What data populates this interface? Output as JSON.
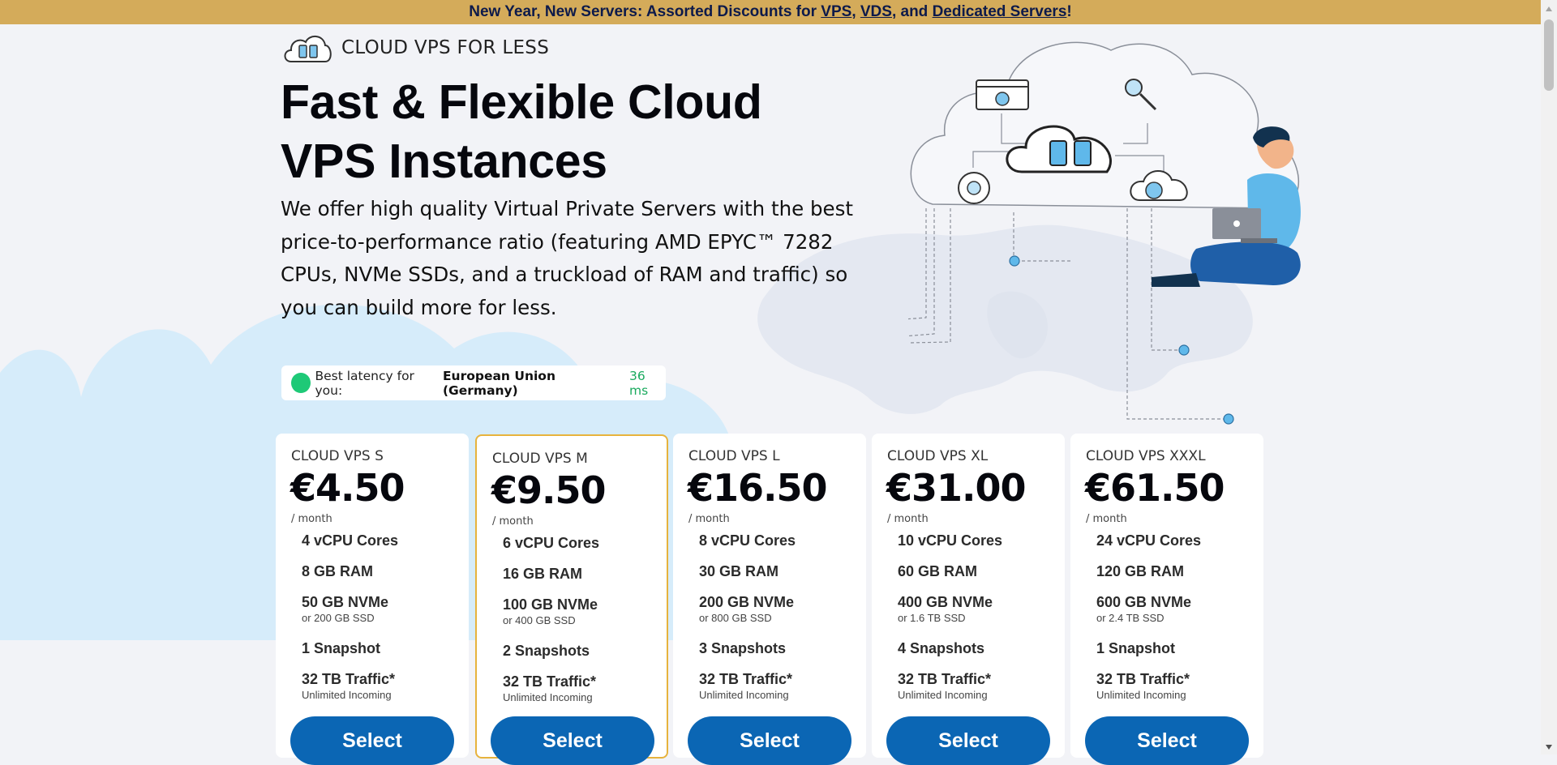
{
  "banner": {
    "prefix": "New Year, New Servers: Assorted Discounts for ",
    "link_vps": "VPS",
    "sep1": ", ",
    "link_vds": "VDS",
    "sep2": ", and ",
    "link_dedicated": "Dedicated Servers",
    "suffix": "!",
    "bg_color": "#d4ab5a"
  },
  "brand": {
    "name": "CLOUD VPS FOR LESS",
    "icon": "cloud-servers-icon"
  },
  "hero": {
    "title": "Fast & Flexible Cloud VPS Instances",
    "description": "We offer high quality Virtual Private Servers with the best price-to-performance ratio (featuring AMD EPYC™ 7282 CPUs, NVMe SSDs, and a truckload of RAM and traffic) so you can build more for less."
  },
  "latency": {
    "label": "Best latency for you:",
    "region": "European Union (Germany)",
    "value": "36 ms",
    "status_color": "#1ec977"
  },
  "colors": {
    "accent_button": "#0b66b4",
    "featured_border": "#e7b33d",
    "background": "#f2f3f7"
  },
  "plans": [
    {
      "name": "CLOUD VPS S",
      "price": "€4.50",
      "period": "/ month",
      "cores": "4 vCPU Cores",
      "ram": "8 GB RAM",
      "storage": "50 GB NVMe",
      "storage_alt": "or 200 GB SSD",
      "snapshots": "1 Snapshot",
      "traffic": "32 TB Traffic*",
      "traffic_note": "Unlimited Incoming",
      "button": "Select",
      "featured": false
    },
    {
      "name": "CLOUD VPS M",
      "price": "€9.50",
      "period": "/ month",
      "cores": "6 vCPU Cores",
      "ram": "16 GB RAM",
      "storage": "100 GB NVMe",
      "storage_alt": "or 400 GB SSD",
      "snapshots": "2 Snapshots",
      "traffic": "32 TB Traffic*",
      "traffic_note": "Unlimited Incoming",
      "button": "Select",
      "featured": true
    },
    {
      "name": "CLOUD VPS L",
      "price": "€16.50",
      "period": "/ month",
      "cores": "8 vCPU Cores",
      "ram": "30 GB RAM",
      "storage": "200 GB NVMe",
      "storage_alt": "or 800 GB SSD",
      "snapshots": "3 Snapshots",
      "traffic": "32 TB Traffic*",
      "traffic_note": "Unlimited Incoming",
      "button": "Select",
      "featured": false
    },
    {
      "name": "CLOUD VPS XL",
      "price": "€31.00",
      "period": "/ month",
      "cores": "10 vCPU Cores",
      "ram": "60 GB RAM",
      "storage": "400 GB NVMe",
      "storage_alt": "or 1.6 TB SSD",
      "snapshots": "4 Snapshots",
      "traffic": "32 TB Traffic*",
      "traffic_note": "Unlimited Incoming",
      "button": "Select",
      "featured": false
    },
    {
      "name": "CLOUD VPS XXXL",
      "price": "€61.50",
      "period": "/ month",
      "cores": "24 vCPU Cores",
      "ram": "120 GB RAM",
      "storage": "600 GB NVMe",
      "storage_alt": "or 2.4 TB SSD",
      "snapshots": "1 Snapshot",
      "traffic": "32 TB Traffic*",
      "traffic_note": "Unlimited Incoming",
      "button": "Select",
      "featured": false
    }
  ]
}
